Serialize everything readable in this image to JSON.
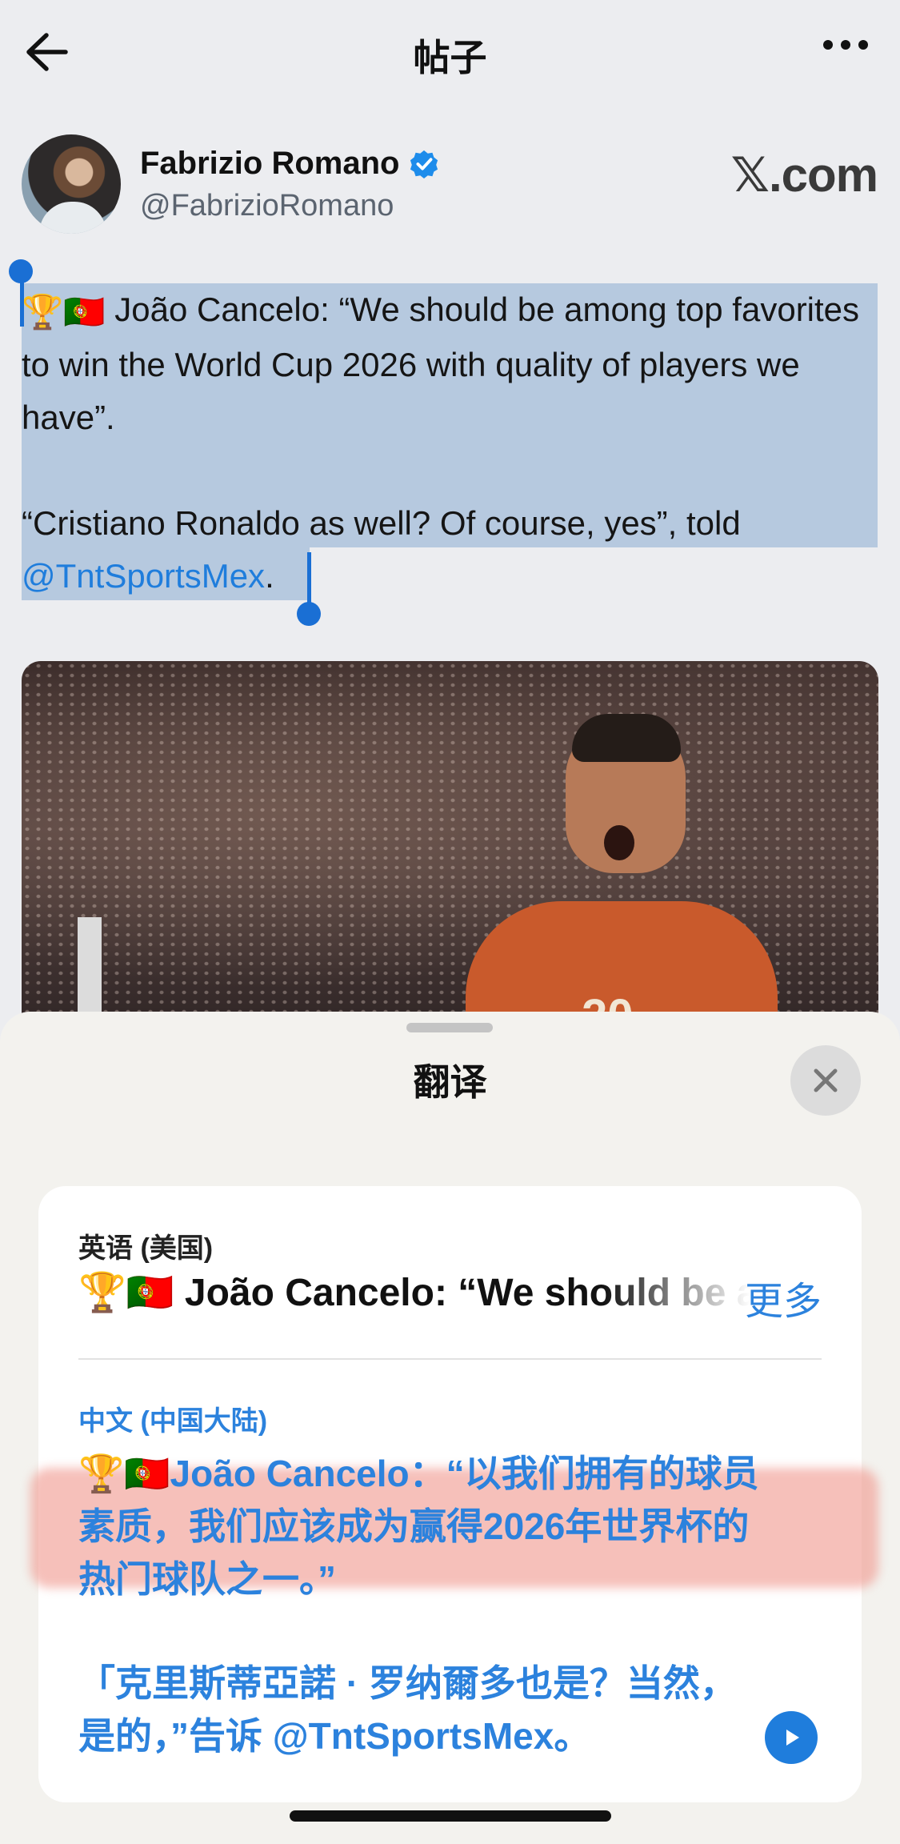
{
  "nav": {
    "title": "帖子",
    "back_icon": "back-arrow-icon",
    "more_icon": "more-dots-icon"
  },
  "author": {
    "name": "Fabrizio Romano",
    "handle": "@FabrizioRomano",
    "verified": true,
    "source": "𝕏.com"
  },
  "tweet": {
    "line1_prefix": "🏆🇵🇹",
    "paragraph1": "João Cancelo: “We should be among top favorites to win the World Cup 2026 with quality of players we have”.",
    "paragraph2": "“Cristiano Ronaldo as well? Of course, yes”, told",
    "mention": "@TntSportsMex",
    "trailing": "."
  },
  "translate_sheet": {
    "title": "翻译",
    "close_icon": "close-icon",
    "source_language": "英语 (美国)",
    "source_text": "🏆🇵🇹 João Cancelo: “We should be among top favorites",
    "more_label": "更多",
    "target_language": "中文 (中国大陆)",
    "target_paragraph1": "🏆🇵🇹João Cancelo：“以我们拥有的球员素质，我们应该成为赢得2026年世界杯的热门球队之一。”",
    "target_paragraph2": "「克里斯蒂亞諾 · 罗纳爾多也是？当然，是的，”告诉 @TntSportsMex。",
    "play_icon": "play-icon"
  },
  "colors": {
    "accent_blue": "#2c82dd",
    "selection": "#b6c9df",
    "highlight": "#f0968c"
  }
}
